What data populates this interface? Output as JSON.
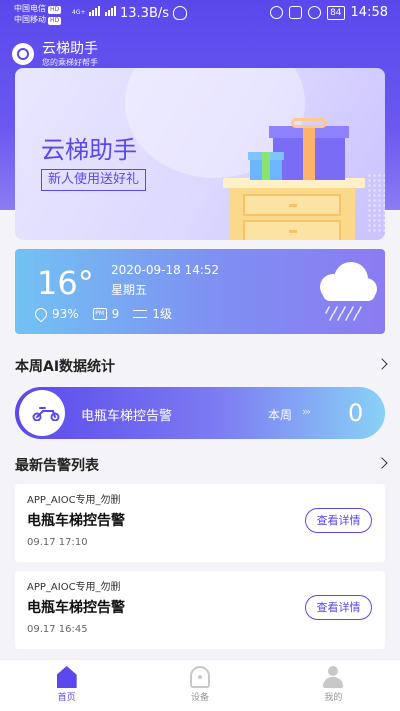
{
  "status_bar": {
    "carrier1": "中国电信",
    "carrier2": "中国移动",
    "hd": "HD",
    "network": "4G+",
    "speed": "13.3B/s",
    "battery": "84",
    "time": "14:58"
  },
  "app": {
    "title": "云梯助手",
    "subtitle": "您的乘梯好帮手"
  },
  "banner": {
    "title": "云梯助手",
    "tag": "新人使用送好礼"
  },
  "weather": {
    "temperature": "16°",
    "datetime": "2020-09-18 14:52",
    "weekday": "星期五",
    "humidity": "93%",
    "pm_label": "PM",
    "pm_value": "9",
    "wind": "1级",
    "icon": "rain-cloud-icon"
  },
  "ai_stats": {
    "heading": "本周AI数据统计",
    "label": "电瓶车梯控告警",
    "period": "本周",
    "arrows": "›››",
    "count": "0"
  },
  "alerts": {
    "heading": "最新告警列表",
    "items": [
      {
        "source": "APP_AIOC专用_勿删",
        "title": "电瓶车梯控告警",
        "time": "09.17 17:10",
        "button": "查看详情"
      },
      {
        "source": "APP_AIOC专用_勿删",
        "title": "电瓶车梯控告警",
        "time": "09.17 16:45",
        "button": "查看详情"
      }
    ]
  },
  "nav": {
    "items": [
      {
        "label": "首页",
        "icon": "home-icon"
      },
      {
        "label": "设备",
        "icon": "device-icon"
      },
      {
        "label": "我的",
        "icon": "profile-icon"
      }
    ]
  },
  "colors": {
    "primary": "#5a48ec",
    "weather_start": "#72c2f3",
    "weather_end": "#8b7cf2"
  }
}
